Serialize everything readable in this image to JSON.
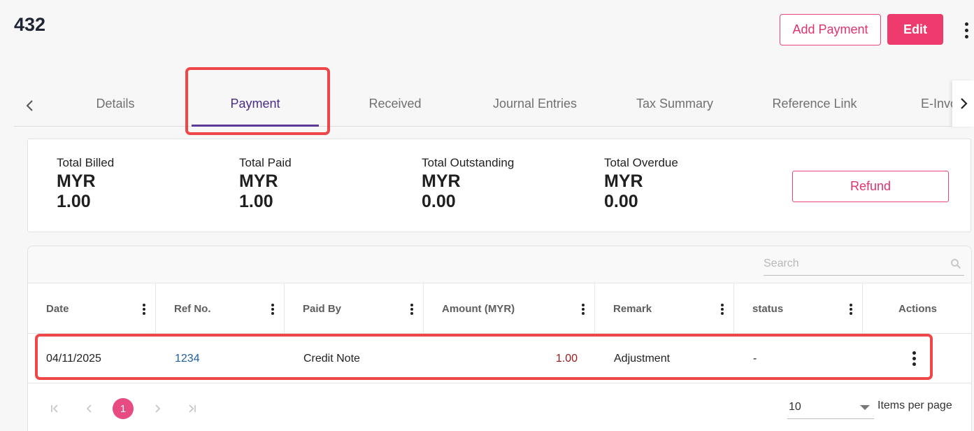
{
  "header": {
    "title": "432",
    "add_payment_label": "Add Payment",
    "edit_label": "Edit",
    "more_icon": "vertical-ellipsis-icon"
  },
  "tabs": {
    "items": [
      {
        "label": "Details",
        "active": false
      },
      {
        "label": "Payment",
        "active": true
      },
      {
        "label": "Received",
        "active": false
      },
      {
        "label": "Journal Entries",
        "active": false
      },
      {
        "label": "Tax Summary",
        "active": false
      },
      {
        "label": "Reference Link",
        "active": false
      },
      {
        "label": "E-Invoice",
        "active": false
      }
    ],
    "prev_icon": "chevron-left-icon",
    "next_icon": "chevron-right-icon"
  },
  "summary": {
    "stats": [
      {
        "label": "Total Billed",
        "currency": "MYR",
        "value": "1.00"
      },
      {
        "label": "Total Paid",
        "currency": "MYR",
        "value": "1.00"
      },
      {
        "label": "Total Outstanding",
        "currency": "MYR",
        "value": "0.00"
      },
      {
        "label": "Total Overdue",
        "currency": "MYR",
        "value": "0.00"
      }
    ],
    "refund_label": "Refund"
  },
  "table": {
    "search_placeholder": "Search",
    "columns": [
      "Date",
      "Ref No.",
      "Paid By",
      "Amount (MYR)",
      "Remark",
      "status",
      "Actions"
    ],
    "rows": [
      {
        "date": "04/11/2025",
        "ref_no": "1234",
        "paid_by": "Credit Note",
        "amount": "1.00",
        "remark": "Adjustment",
        "status": "-"
      }
    ]
  },
  "pagination": {
    "current_page": "1",
    "items_per_page": "10",
    "items_per_page_label": "Items per page"
  },
  "colors": {
    "accent": "#ec3b6c",
    "tab_active": "#4b2c86",
    "highlight": "#ef4747",
    "link": "#1f5f9e",
    "amount": "#9b1a1a"
  }
}
